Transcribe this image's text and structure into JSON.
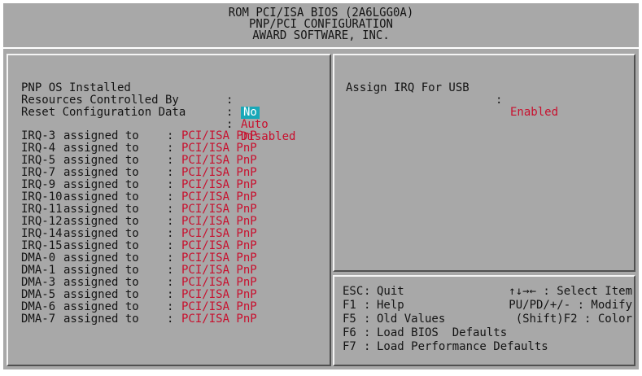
{
  "header": {
    "line1": "ROM PCI/ISA BIOS (2A6LGG0A)",
    "line2": "PNP/PCI CONFIGURATION",
    "line3": "AWARD SOFTWARE, INC."
  },
  "settings": [
    {
      "label": "PNP OS Installed",
      "value": "No",
      "selected": true
    },
    {
      "label": "Resources Controlled By",
      "value": "Auto",
      "selected": false
    },
    {
      "label": "Reset Configuration Data",
      "value": "Disabled",
      "selected": false
    }
  ],
  "colon": ":",
  "assigned_text": "assigned to",
  "irq_list": [
    {
      "label": "IRQ-3",
      "value": "PCI/ISA PnP"
    },
    {
      "label": "IRQ-4",
      "value": "PCI/ISA PnP"
    },
    {
      "label": "IRQ-5",
      "value": "PCI/ISA PnP"
    },
    {
      "label": "IRQ-7",
      "value": "PCI/ISA PnP"
    },
    {
      "label": "IRQ-9",
      "value": "PCI/ISA PnP"
    },
    {
      "label": "IRQ-10",
      "value": "PCI/ISA PnP"
    },
    {
      "label": "IRQ-11",
      "value": "PCI/ISA PnP"
    },
    {
      "label": "IRQ-12",
      "value": "PCI/ISA PnP"
    },
    {
      "label": "IRQ-14",
      "value": "PCI/ISA PnP"
    },
    {
      "label": "IRQ-15",
      "value": "PCI/ISA PnP"
    },
    {
      "label": "DMA-0",
      "value": "PCI/ISA PnP"
    },
    {
      "label": "DMA-1",
      "value": "PCI/ISA PnP"
    },
    {
      "label": "DMA-3",
      "value": "PCI/ISA PnP"
    },
    {
      "label": "DMA-5",
      "value": "PCI/ISA PnP"
    },
    {
      "label": "DMA-6",
      "value": "PCI/ISA PnP"
    },
    {
      "label": "DMA-7",
      "value": "PCI/ISA PnP"
    }
  ],
  "usb": {
    "label": "Assign IRQ For USB",
    "value": "Enabled"
  },
  "help": [
    {
      "key": "ESC",
      "desc": "Quit",
      "right": "↑↓→← : Select Item"
    },
    {
      "key": "F1",
      "desc": "Help",
      "right": "PU/PD/+/- : Modify"
    },
    {
      "key": "F5",
      "desc": "Old Values",
      "right": "(Shift)F2 : Color"
    },
    {
      "key": "F6",
      "desc": "Load BIOS  Defaults",
      "right": ""
    },
    {
      "key": "F7",
      "desc": "Load Performance Defaults",
      "right": ""
    }
  ],
  "colors": {
    "background": "#a8a8a8",
    "value_text": "#c8102e",
    "highlight": "#18a8b8",
    "label_text": "#141414"
  }
}
